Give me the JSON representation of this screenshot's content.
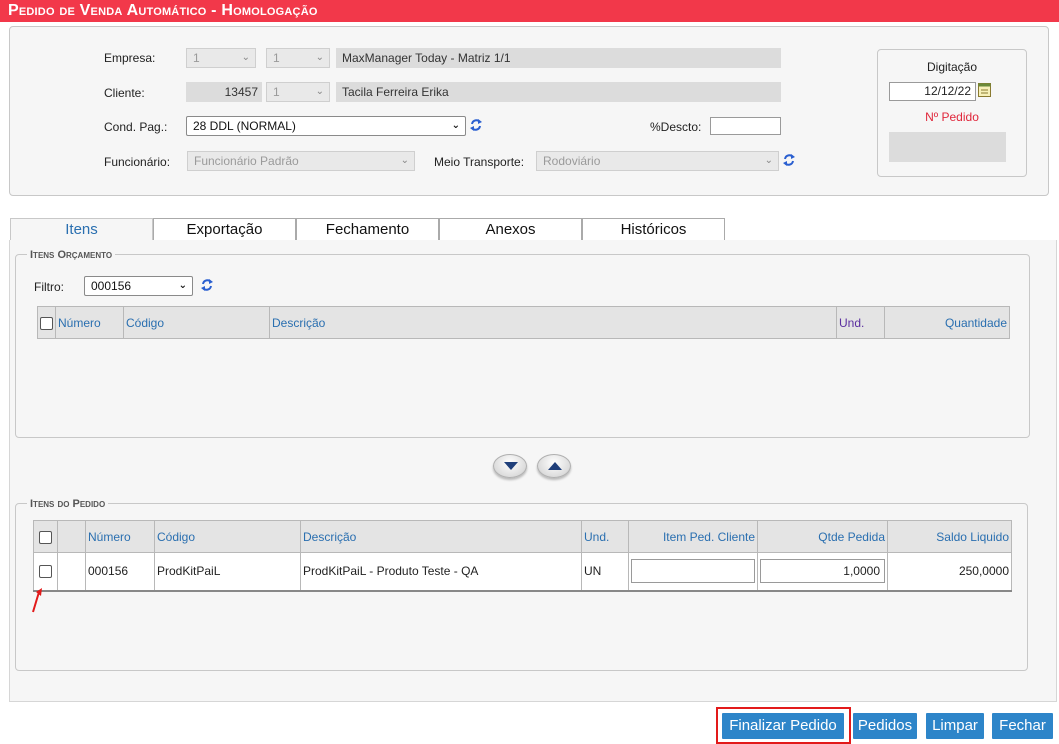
{
  "app": {
    "title": "Pedido de Venda Automático  - Homologação"
  },
  "header": {
    "empresa": {
      "label": "Empresa:",
      "select1": "1",
      "select2": "1",
      "name": "MaxManager Today - Matriz 1/1"
    },
    "cliente": {
      "label": "Cliente:",
      "code": "13457",
      "select": "1",
      "name": "Tacila Ferreira Erika"
    },
    "cond_pag": {
      "label": "Cond. Pag.:",
      "value": "28 DDL (NORMAL)"
    },
    "desconto": {
      "label": "%Descto:",
      "value": ""
    },
    "funcionario": {
      "label": "Funcionário:",
      "value": "Funcionário Padrão"
    },
    "meio_transporte": {
      "label": "Meio Transporte:",
      "value": "Rodoviário"
    },
    "digitacao": {
      "label": "Digitação",
      "date": "12/12/22",
      "pedido_label": "Nº Pedido",
      "pedido_value": ""
    }
  },
  "tabs": [
    {
      "label": "Itens",
      "active": true
    },
    {
      "label": "Exportação",
      "active": false
    },
    {
      "label": "Fechamento",
      "active": false
    },
    {
      "label": "Anexos",
      "active": false
    },
    {
      "label": "Históricos",
      "active": false
    }
  ],
  "itens_orcamento": {
    "legend": "Itens Orçamento",
    "filtro_label": "Filtro:",
    "filtro_value": "000156",
    "columns": [
      "Número",
      "Código",
      "Descrição",
      "Und.",
      "Quantidade"
    ]
  },
  "itens_pedido": {
    "legend": "Itens do Pedido",
    "columns": [
      "Número",
      "Código",
      "Descrição",
      "Und.",
      "Item Ped. Cliente",
      "Qtde Pedida",
      "Saldo Liquido"
    ],
    "rows": [
      {
        "numero": "000156",
        "codigo": "ProdKitPaiL",
        "descricao": "ProdKitPaiL - Produto Teste - QA",
        "und": "UN",
        "item_ped_cliente": "",
        "qtde_pedida": "1,0000",
        "saldo_liquido": "250,0000"
      }
    ]
  },
  "buttons": {
    "finalizar": "Finalizar Pedido",
    "pedidos": "Pedidos",
    "limpar": "Limpar",
    "fechar": "Fechar"
  },
  "colors": {
    "title_bar": "#f2384a",
    "accent_blue": "#2d85c9",
    "highlight_red": "#e21a1a"
  },
  "icons": [
    "refresh-icon",
    "calendar-icon",
    "arrow-down-icon",
    "arrow-up-icon",
    "chevron-down-icon"
  ]
}
